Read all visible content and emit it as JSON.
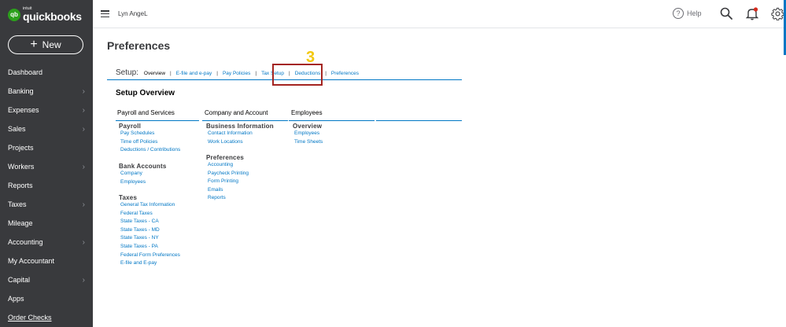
{
  "brand": {
    "logo_small": "intuit",
    "logo_name": "quickbooks",
    "logo_mark": "qb"
  },
  "sidebar": {
    "new_label": "New",
    "items": [
      {
        "label": "Dashboard",
        "chevron": false
      },
      {
        "label": "Banking",
        "chevron": true
      },
      {
        "label": "Expenses",
        "chevron": true
      },
      {
        "label": "Sales",
        "chevron": true
      },
      {
        "label": "Projects",
        "chevron": false
      },
      {
        "label": "Workers",
        "chevron": true
      },
      {
        "label": "Reports",
        "chevron": false
      },
      {
        "label": "Taxes",
        "chevron": true
      },
      {
        "label": "Mileage",
        "chevron": false
      },
      {
        "label": "Accounting",
        "chevron": true
      },
      {
        "label": "My Accountant",
        "chevron": false
      },
      {
        "label": "Capital",
        "chevron": true
      },
      {
        "label": "Apps",
        "chevron": false
      },
      {
        "label": "Order Checks",
        "chevron": false
      }
    ],
    "chevron_glyph": "›"
  },
  "topbar": {
    "company": "Lyn AngeL",
    "help_label": "Help",
    "help_glyph": "?"
  },
  "page": {
    "title": "Preferences"
  },
  "setup": {
    "label": "Setup:",
    "current": "Overview",
    "separator": "|",
    "links": [
      "E-file and e-pay",
      "Pay Policies",
      "Tax Setup",
      "Deductions",
      "Preferences"
    ],
    "step_number": "3"
  },
  "overview": {
    "title": "Setup Overview",
    "columns": [
      {
        "header": "Payroll and Services",
        "sections": [
          {
            "title": "Payroll",
            "links": [
              "Pay Schedules",
              "Time off Policies",
              "Deductions / Contributions"
            ]
          },
          {
            "title": "Bank Accounts",
            "links": [
              "Company",
              "Employees"
            ]
          },
          {
            "title": "Taxes",
            "links": [
              "General Tax Information",
              "Federal Taxes",
              "State Taxes - CA",
              "State Taxes - MD",
              "State Taxes - NY",
              "State Taxes - PA",
              "Federal Form Preferences",
              "E-file and E-pay"
            ]
          }
        ]
      },
      {
        "header": "Company and Account",
        "sections": [
          {
            "title": "Business Information",
            "links": [
              "Contact Information",
              "Work Locations"
            ]
          },
          {
            "title": "Preferences",
            "links": [
              "Accounting",
              "Paycheck Printing",
              "Form Printing",
              "Emails",
              "Reports"
            ]
          }
        ]
      },
      {
        "header": "Employees",
        "sections": [
          {
            "title": "Overview",
            "links": [
              "Employees",
              "Time Sheets"
            ]
          }
        ]
      }
    ]
  },
  "colors": {
    "sidebar": "#393a3d",
    "brand_green": "#2ca01c",
    "link_blue": "#0077c5",
    "highlight_red": "#a42420",
    "step_yellow": "#f3c80c"
  }
}
